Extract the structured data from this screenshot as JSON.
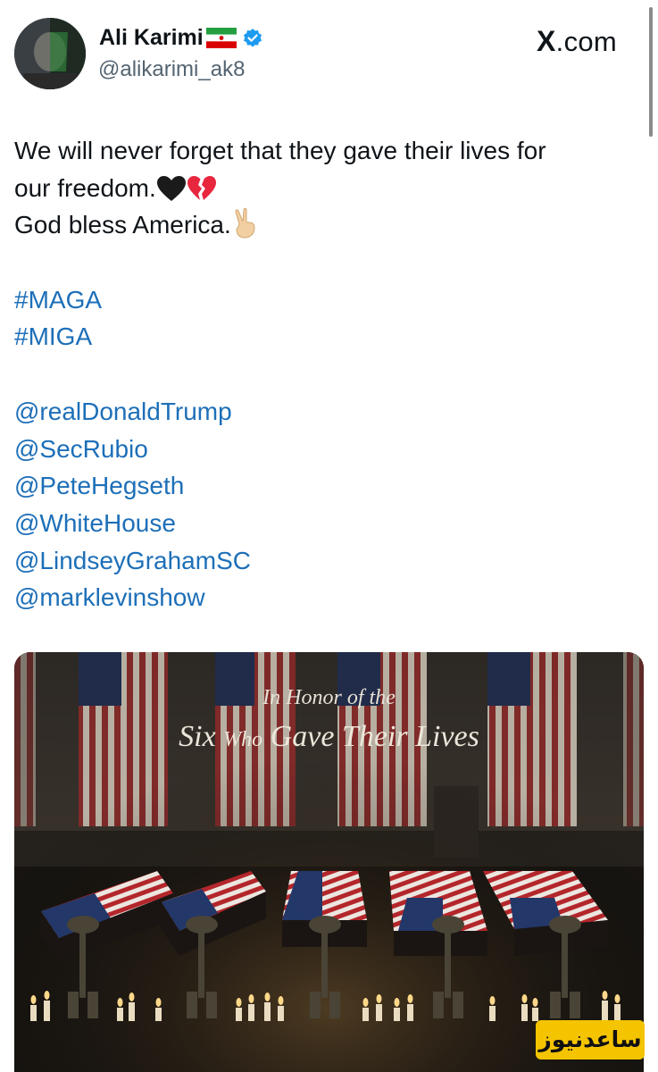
{
  "author": {
    "name": "Ali Karimi",
    "handle": "@alikarimi_ak8",
    "flag_icon": "iran-flag-icon",
    "verified_icon": "verified-badge-icon"
  },
  "site": {
    "logo_letter": "X",
    "logo_suffix": ".com"
  },
  "tweet": {
    "line1": "We will never forget that they gave their lives for",
    "line2": "our freedom.",
    "line2_emojis": [
      "black-heart-icon",
      "broken-heart-icon"
    ],
    "line3": "God bless America.",
    "line3_emoji": "victory-hand-icon",
    "hashtags": [
      "#MAGA",
      "#MIGA"
    ],
    "mentions": [
      "@realDonaldTrump",
      "@SecRubio",
      "@PeteHegseth",
      "@WhiteHouse",
      "@LindseyGrahamSC",
      "@marklevinshow"
    ]
  },
  "media": {
    "caption_line1": "In Honor of the",
    "caption_line2_a": "Six",
    "caption_line2_b": "Who",
    "caption_line2_c": "Gave Their Lives",
    "description_icons": [
      "flag-draped-coffin-icon",
      "memorial-helmet-rifle-icon",
      "candle-icon"
    ]
  },
  "watermark": {
    "text": "ساعدنیوز"
  },
  "colors": {
    "link": "#1d6fb8",
    "verified": "#1d9bf0",
    "watermark_bg": "#f5c400"
  }
}
